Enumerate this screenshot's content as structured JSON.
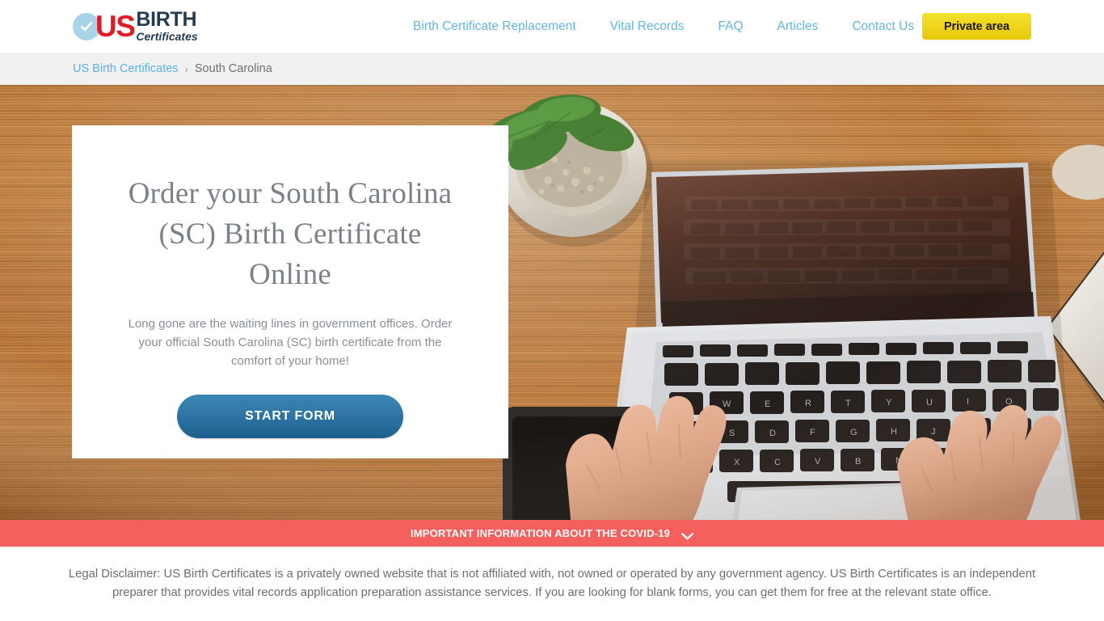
{
  "header": {
    "logo": {
      "check_icon": "check-circle-icon",
      "us": "US",
      "birth": "BIRTH",
      "certificates": "Certificates"
    },
    "nav_items": [
      {
        "label": "Birth Certificate Replacement"
      },
      {
        "label": "Vital Records"
      },
      {
        "label": "FAQ"
      },
      {
        "label": "Articles"
      },
      {
        "label": "Contact Us"
      }
    ],
    "private_area_label": "Private area",
    "private_area_color": "#efd41d"
  },
  "breadcrumb": {
    "home_label": "US Birth Certificates",
    "separator": "›",
    "current_label": "South Carolina"
  },
  "hero": {
    "title": "Order your South Carolina (SC) Birth Certificate Online",
    "subtitle": "Long gone are the waiting lines in government offices. Order your official South Carolina (SC) birth certificate from the comfort of your home!",
    "cta_label": "START FORM",
    "cta_color": "#2f76a4",
    "background_description": "Top-down photo of hands typing on a silver laptop on a wooden desk with a potted plant, a black tablet and a white notebook"
  },
  "covid_banner": {
    "text": "IMPORTANT INFORMATION ABOUT THE COVID-19",
    "icon": "chevron-down-icon",
    "background_color": "#f4605e"
  },
  "disclaimer": {
    "text": "Legal Disclaimer: US Birth Certificates is a privately owned website that is not affiliated with, not owned or operated by any government agency. US Birth Certificates is an independent preparer that provides vital records application preparation assistance services. If you are looking for blank forms, you can get them for free at the relevant state office."
  }
}
